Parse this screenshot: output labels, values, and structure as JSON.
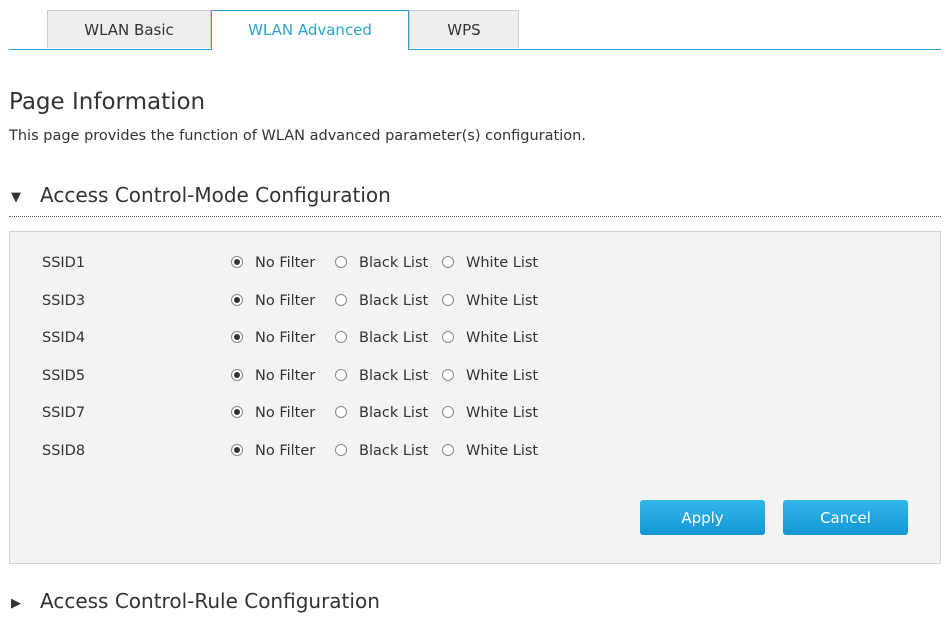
{
  "tabs": [
    {
      "label": "WLAN Basic"
    },
    {
      "label": "WLAN Advanced"
    },
    {
      "label": "WPS"
    }
  ],
  "active_tab": "WLAN Advanced",
  "page": {
    "title": "Page Information",
    "description": "This page provides the function of WLAN advanced parameter(s) configuration."
  },
  "sections": {
    "mode": {
      "label": "Access Control-Mode Configuration",
      "expanded": true
    },
    "rule": {
      "label": "Access Control-Rule Configuration",
      "expanded": false
    }
  },
  "options": [
    "No Filter",
    "Black List",
    "White List"
  ],
  "rows": [
    {
      "ssid": "SSID1",
      "selected": "No Filter"
    },
    {
      "ssid": "SSID3",
      "selected": "No Filter"
    },
    {
      "ssid": "SSID4",
      "selected": "No Filter"
    },
    {
      "ssid": "SSID5",
      "selected": "No Filter"
    },
    {
      "ssid": "SSID7",
      "selected": "No Filter"
    },
    {
      "ssid": "SSID8",
      "selected": "No Filter"
    }
  ],
  "buttons": {
    "apply": "Apply",
    "cancel": "Cancel"
  },
  "colors": {
    "accent": "#2aa3d0",
    "button": "#1fa6df",
    "panel_bg": "#f3f3f3"
  }
}
